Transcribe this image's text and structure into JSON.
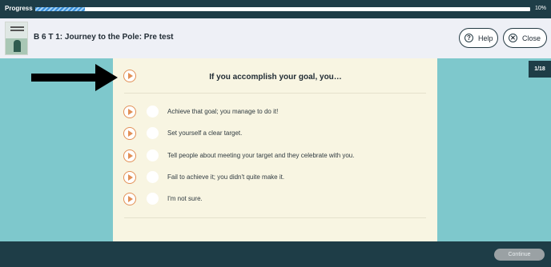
{
  "progress": {
    "label": "Progress",
    "percent_text": "10%",
    "fraction": 0.1
  },
  "header": {
    "title": "B 6 T 1: Journey to the Pole: Pre test",
    "thumbnail_icon": "book-cover-thumbnail",
    "help_label": "Help",
    "help_icon": "question-circle-icon",
    "close_label": "Close",
    "close_icon": "x-circle-icon"
  },
  "counter": "1/18",
  "question": {
    "text": "If you accomplish your goal, you…",
    "audio_icon": "play-audio-icon"
  },
  "options": [
    {
      "label": "Achieve that goal; you manage to do it!"
    },
    {
      "label": "Set yourself a clear target."
    },
    {
      "label": "Tell people about meeting your target and they celebrate with you."
    },
    {
      "label": "Fail to achieve it; you didn't quite make it."
    },
    {
      "label": "I'm not sure."
    }
  ],
  "footer": {
    "continue_label": "Continue"
  },
  "annotation": {
    "icon": "black-arrow-right"
  },
  "colors": {
    "dark_teal": "#1e3d47",
    "background_teal": "#7ec8cc",
    "card": "#f8f5e2",
    "audio_orange": "#e29057",
    "progress_blue": "#3a8fd9",
    "continue_disabled": "#9aa1a4"
  }
}
